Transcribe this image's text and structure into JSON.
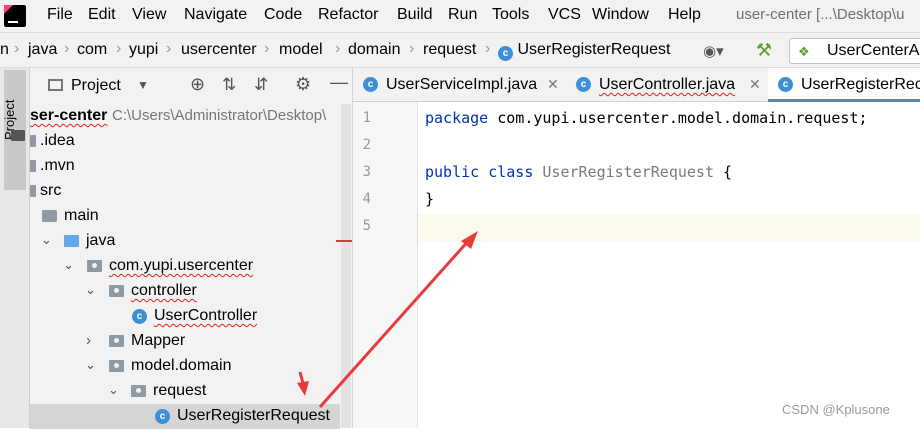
{
  "menubar": {
    "items": [
      "File",
      "Edit",
      "View",
      "Navigate",
      "Code",
      "Refactor",
      "Build",
      "Run",
      "Tools",
      "VCS",
      "Window",
      "Help"
    ],
    "window_title": "user-center [...\\Desktop\\u"
  },
  "breadcrumbs": [
    "n",
    "java",
    "com",
    "yupi",
    "usercenter",
    "model",
    "domain",
    "request",
    "UserRegisterRequest"
  ],
  "toolbar": {
    "run_config": "UserCenterA"
  },
  "tool_strip": {
    "project_label": "Project"
  },
  "project_panel": {
    "title": "Project",
    "root": {
      "name": "ser-center",
      "path": "C:\\Users\\Administrator\\Desktop\\"
    },
    "tree": [
      {
        "label": ".idea"
      },
      {
        "label": ".mvn"
      },
      {
        "label": "src"
      },
      {
        "label": "main"
      },
      {
        "label": "java"
      },
      {
        "label": "com.yupi.usercenter"
      },
      {
        "label": "controller"
      },
      {
        "label": "UserController"
      },
      {
        "label": "Mapper"
      },
      {
        "label": "model.domain"
      },
      {
        "label": "request"
      },
      {
        "label": "UserRegisterRequest"
      }
    ]
  },
  "editor": {
    "tabs": [
      "UserServiceImpl.java",
      "UserController.java",
      "UserRegisterRec"
    ],
    "line_numbers": [
      "1",
      "2",
      "3",
      "4",
      "5"
    ],
    "code": {
      "line1_kw": "package",
      "line1_rest": " com.yupi.usercenter.model.domain.request;",
      "line3_kw": "public class",
      "line3_name": "UserRegisterRequest",
      "line3_brace": " {",
      "line4": "}"
    }
  },
  "class_icon_letter": "c",
  "watermark": "CSDN @Kplusone",
  "colors": {
    "arrow": "#e83b3b",
    "keyword": "#0033b3",
    "selection": "#d5d5d5",
    "class_icon": "#3d8fd6"
  }
}
